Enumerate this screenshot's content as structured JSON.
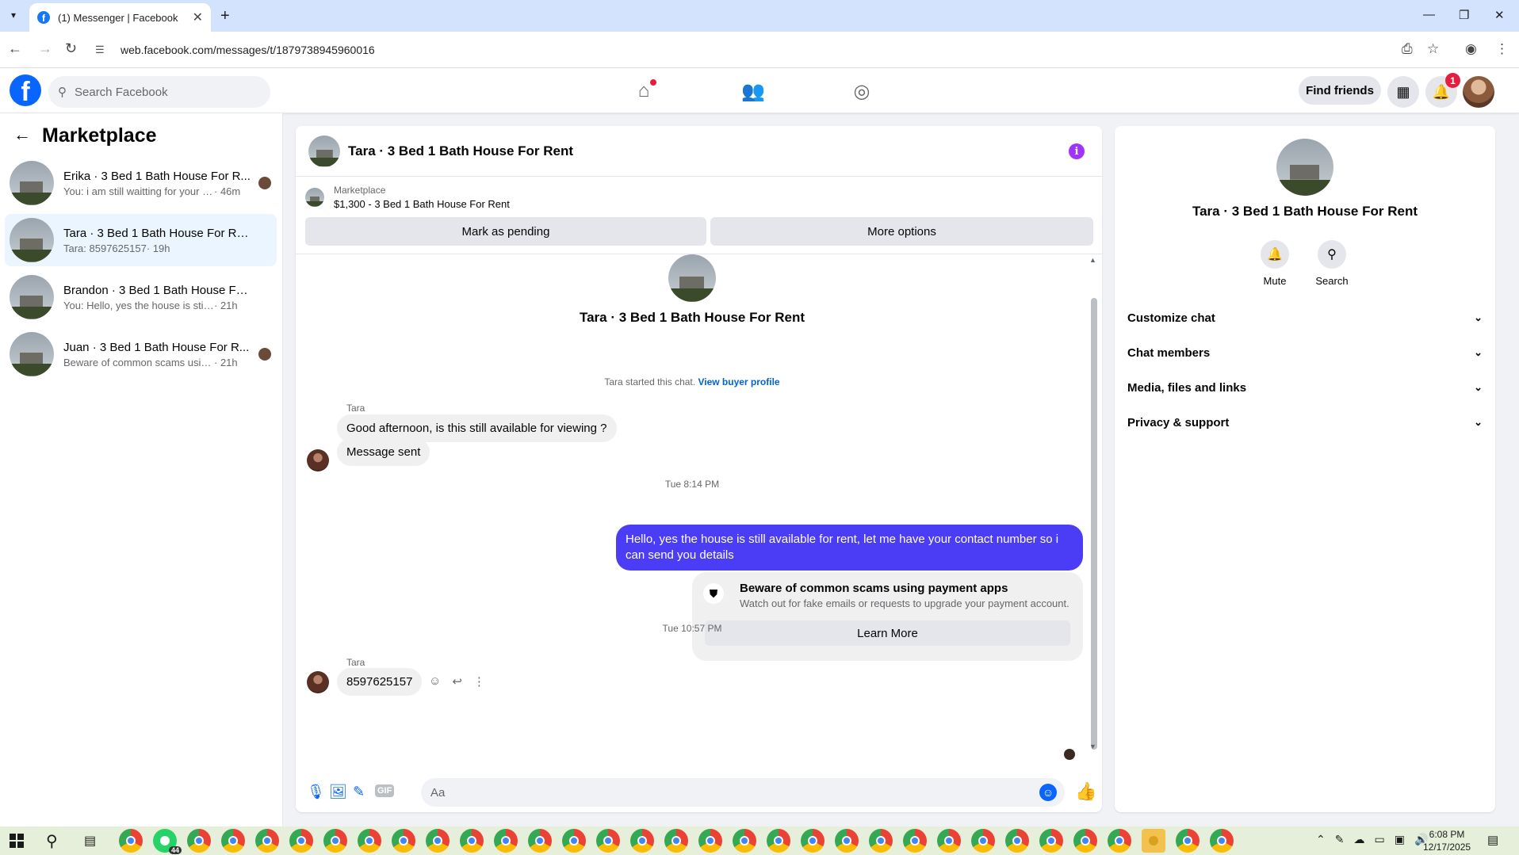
{
  "browser": {
    "tab_title": "(1) Messenger | Facebook",
    "url": "web.facebook.com/messages/t/1879738945960016"
  },
  "header": {
    "search_placeholder": "Search Facebook",
    "find_friends": "Find friends",
    "notification_count": "1"
  },
  "sidebar": {
    "title": "Marketplace",
    "conversations": [
      {
        "name": "Erika · 3 Bed 1 Bath House For R...",
        "snippet": "You: i am still waitting for your re...",
        "time": "· 46m",
        "active": false
      },
      {
        "name": "Tara · 3 Bed 1 Bath House For Rent",
        "snippet": "Tara: 8597625157",
        "time": "· 19h",
        "active": true
      },
      {
        "name": "Brandon · 3 Bed 1 Bath House For ...",
        "snippet": "You: Hello, yes the house is still avail...",
        "time": "· 21h",
        "active": false
      },
      {
        "name": "Juan · 3 Bed 1 Bath House For R...",
        "snippet": "Beware of common scams using ...",
        "time": "· 21h",
        "active": false
      }
    ]
  },
  "chat": {
    "title": "Tara · 3 Bed 1 Bath House For Rent",
    "listing_label": "Marketplace",
    "listing_detail": "$1,300 - 3 Bed 1 Bath House For Rent",
    "mark_pending": "Mark as pending",
    "more_options": "More options",
    "started_text": "Tara started this chat.",
    "view_profile": "View buyer profile",
    "sender_name": "Tara",
    "messages": {
      "m1": "Good afternoon, is this still available for viewing ?",
      "m2": "Message sent",
      "ts1": "Tue 8:14 PM",
      "m3": "Hello, yes the house is still available for rent, let me have your contact number so i can send you  details",
      "ts2": "Tue 10:57 PM",
      "m4": "8597625157"
    },
    "scam": {
      "title": "Beware of common scams using payment apps",
      "subtitle": "Watch out for fake emails or requests to upgrade your payment account.",
      "button": "Learn More"
    },
    "composer_placeholder": "Aa",
    "gif_label": "GIF"
  },
  "info_panel": {
    "title": "Tara · 3 Bed 1 Bath House For Rent",
    "mute": "Mute",
    "search": "Search",
    "sections": [
      "Customize chat",
      "Chat members",
      "Media, files and links",
      "Privacy & support"
    ]
  },
  "taskbar": {
    "time": "6:08 PM",
    "date": "12/17/2025",
    "whatsapp_count": "44"
  }
}
